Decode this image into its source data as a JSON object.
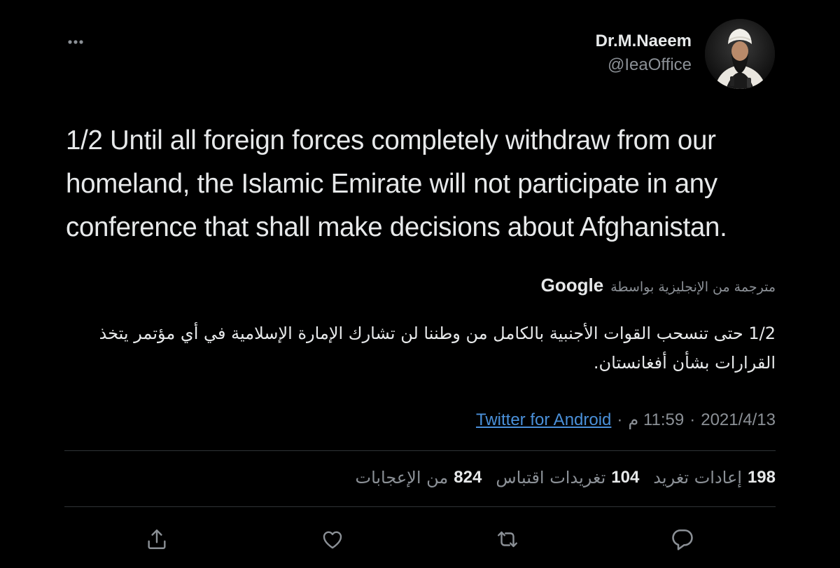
{
  "author": {
    "name": "Dr.M.Naeem",
    "handle": "@IeaOffice"
  },
  "tweet": {
    "text": "1/2 Until all foreign forces completely withdraw from our homeland, the Islamic Emirate will not participate in any conference that shall make decisions about Afghanistan."
  },
  "translation": {
    "label": "مترجمة من الإنجليزية بواسطة",
    "provider": "Google",
    "text": "1/2 حتى تنسحب القوات الأجنبية بالكامل من وطننا لن تشارك الإمارة الإسلامية في أي مؤتمر يتخذ القرارات بشأن أفغانستان."
  },
  "meta": {
    "date": "2021/4/13",
    "sep1": "·",
    "time": "11:59 م",
    "sep2": "·",
    "source": "Twitter for Android"
  },
  "stats": {
    "retweets": {
      "count": "198",
      "label": "إعادات تغريد"
    },
    "quotes": {
      "count": "104",
      "label": "تغريدات اقتباس"
    },
    "likes": {
      "count": "824",
      "label": "من الإعجابات"
    }
  },
  "actions": [
    "reply-icon",
    "retweet-icon",
    "like-icon",
    "share-icon"
  ],
  "colors": {
    "background": "#000000",
    "text": "#e7e9ea",
    "secondary": "#8b9096",
    "link": "#4a90d9",
    "divider": "#2f3336"
  }
}
